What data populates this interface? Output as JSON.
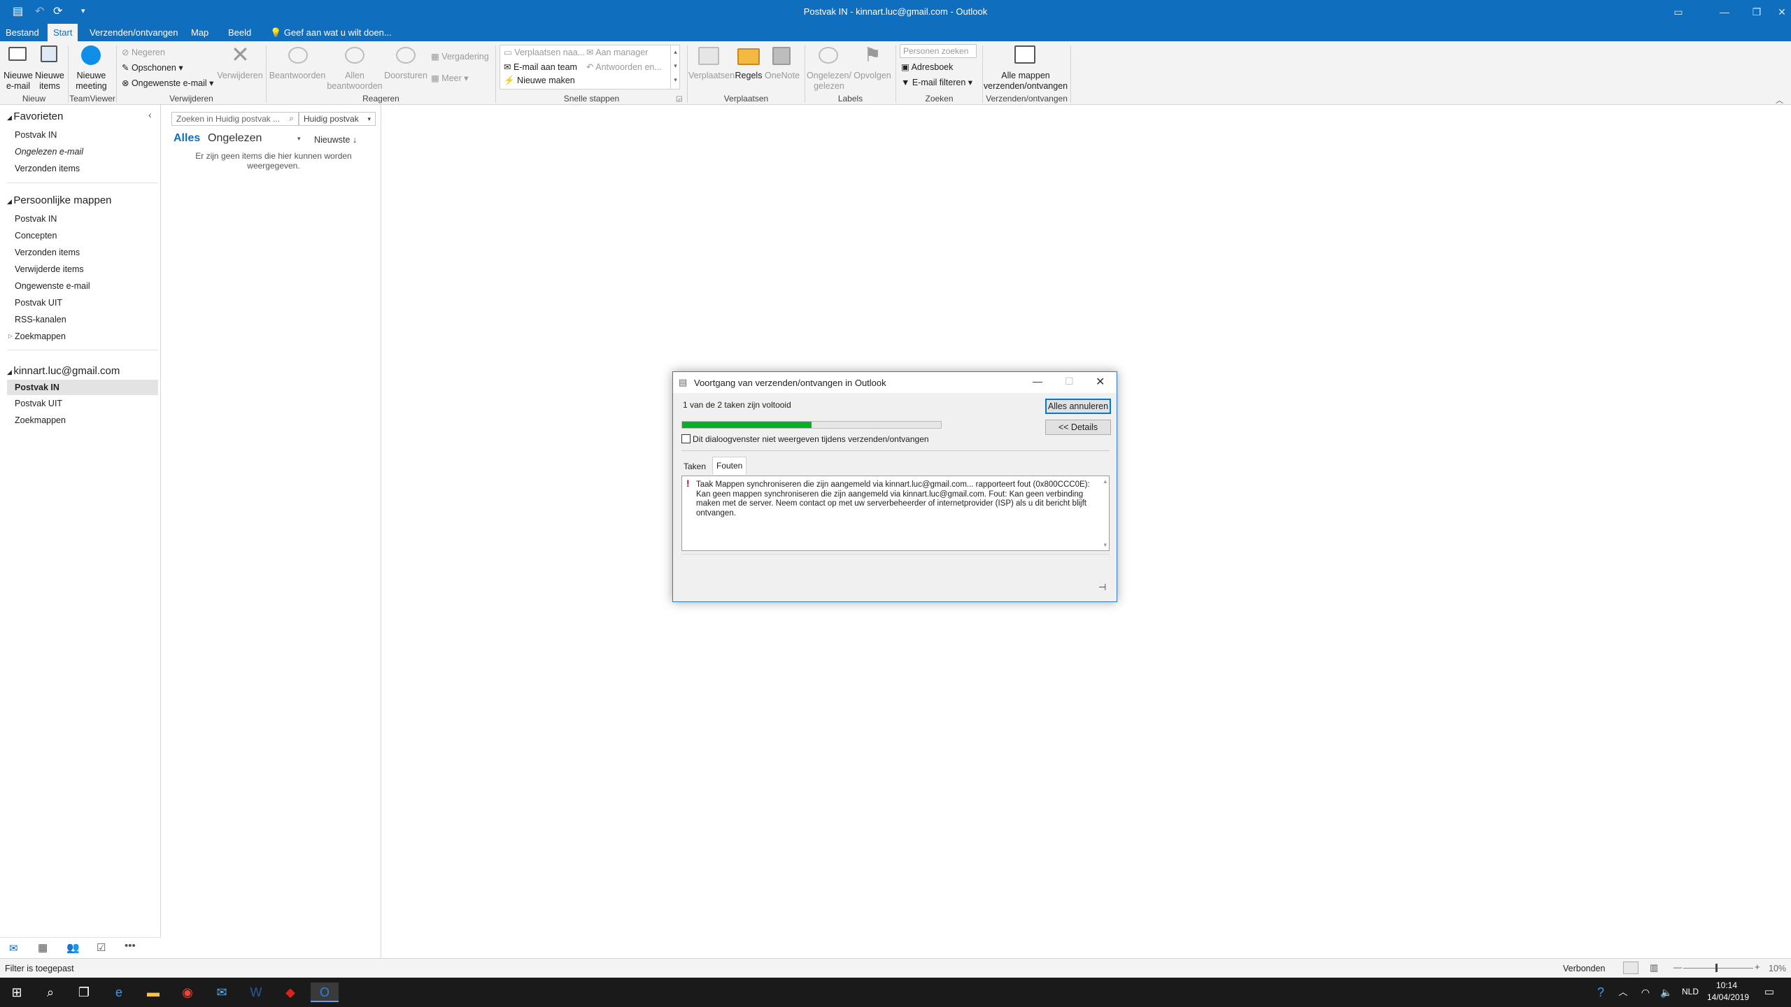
{
  "window": {
    "title": "Postvak IN - kinnart.luc@gmail.com - Outlook"
  },
  "tabs": [
    {
      "label": "Bestand"
    },
    {
      "label": "Start"
    },
    {
      "label": "Verzenden/ontvangen"
    },
    {
      "label": "Map"
    },
    {
      "label": "Beeld"
    }
  ],
  "tellme": "Geef aan wat u wilt doen...",
  "ribbon": {
    "nieuwe_email": "Nieuwe e-mail",
    "nieuwe_items": "Nieuwe items",
    "nieuwe_meeting": "Nieuwe meeting",
    "negeren": "Negeren",
    "opschonen": "Opschonen",
    "ongewenste": "Ongewenste e-mail",
    "verwijderen": "Verwijderen",
    "beantwoorden": "Beantwoorden",
    "allen_beantwoorden": "Allen beantwoorden",
    "doorsturen": "Doorsturen",
    "vergadering": "Vergadering",
    "meer": "Meer",
    "qs_verplaatsen": "Verplaatsen naa...",
    "qs_manager": "Aan manager",
    "qs_team": "E-mail aan team",
    "qs_antwoorden": "Antwoorden en...",
    "qs_nieuw": "Nieuwe maken",
    "verplaatsen": "Verplaatsen",
    "regels": "Regels",
    "onenote": "OneNote",
    "ongelezen_gelezen": "Ongelezen/ gelezen",
    "opvolgen": "Opvolgen",
    "personen_zoeken": "Personen zoeken",
    "adresboek": "Adresboek",
    "email_filteren": "E-mail filteren",
    "alle_mappen": "Alle mappen verzenden/ontvangen",
    "groups": {
      "nieuw": "Nieuw",
      "teamviewer": "TeamViewer",
      "verwijderen": "Verwijderen",
      "reageren": "Reageren",
      "snelle_stappen": "Snelle stappen",
      "verplaatsen": "Verplaatsen",
      "labels": "Labels",
      "zoeken": "Zoeken",
      "verzenden": "Verzenden/ontvangen"
    }
  },
  "nav": {
    "favorieten": "Favorieten",
    "fav_items": [
      "Postvak IN",
      "Ongelezen e-mail",
      "Verzonden items"
    ],
    "persoonlijk": "Persoonlijke mappen",
    "pers_items": [
      "Postvak IN",
      "Concepten",
      "Verzonden items",
      "Verwijderde items",
      "Ongewenste e-mail",
      "Postvak UIT",
      "RSS-kanalen",
      "Zoekmappen"
    ],
    "account": "kinnart.luc@gmail.com",
    "acc_items": [
      "Postvak IN",
      "Postvak UIT",
      "Zoekmappen"
    ]
  },
  "list": {
    "search_placeholder": "Zoeken in Huidig postvak ...",
    "scope": "Huidig postvak",
    "filter_all": "Alles",
    "filter_unread": "Ongelezen",
    "sort": "Nieuwste",
    "empty": "Er zijn geen items die hier kunnen worden weergegeven."
  },
  "dialog": {
    "title": "Voortgang van verzenden/ontvangen in Outlook",
    "progress_text": "1 van de 2 taken zijn voltooid",
    "progress": 0.5,
    "cancel_all": "Alles annuleren",
    "details": "<< Details",
    "checkbox": "Dit dialoogvenster niet weergeven tijdens verzenden/ontvangen",
    "tab_taken": "Taken",
    "tab_fouten": "Fouten",
    "error": "Taak Mappen synchroniseren die zijn aangemeld via kinnart.luc@gmail.com... rapporteert fout (0x800CCC0E): Kan geen mappen synchroniseren die zijn aangemeld via kinnart.luc@gmail.com. Fout: Kan geen verbinding maken met de server. Neem contact op met uw serverbeheerder of internetprovider (ISP) als u dit bericht blijft ontvangen."
  },
  "status": {
    "left": "Filter is toegepast",
    "connected": "Verbonden",
    "zoom": "10%"
  },
  "taskbar": {
    "lang": "NLD",
    "time": "10:14",
    "date": "14/04/2019"
  },
  "colors": {
    "accent": "#106ebe",
    "progress": "#06b025"
  }
}
